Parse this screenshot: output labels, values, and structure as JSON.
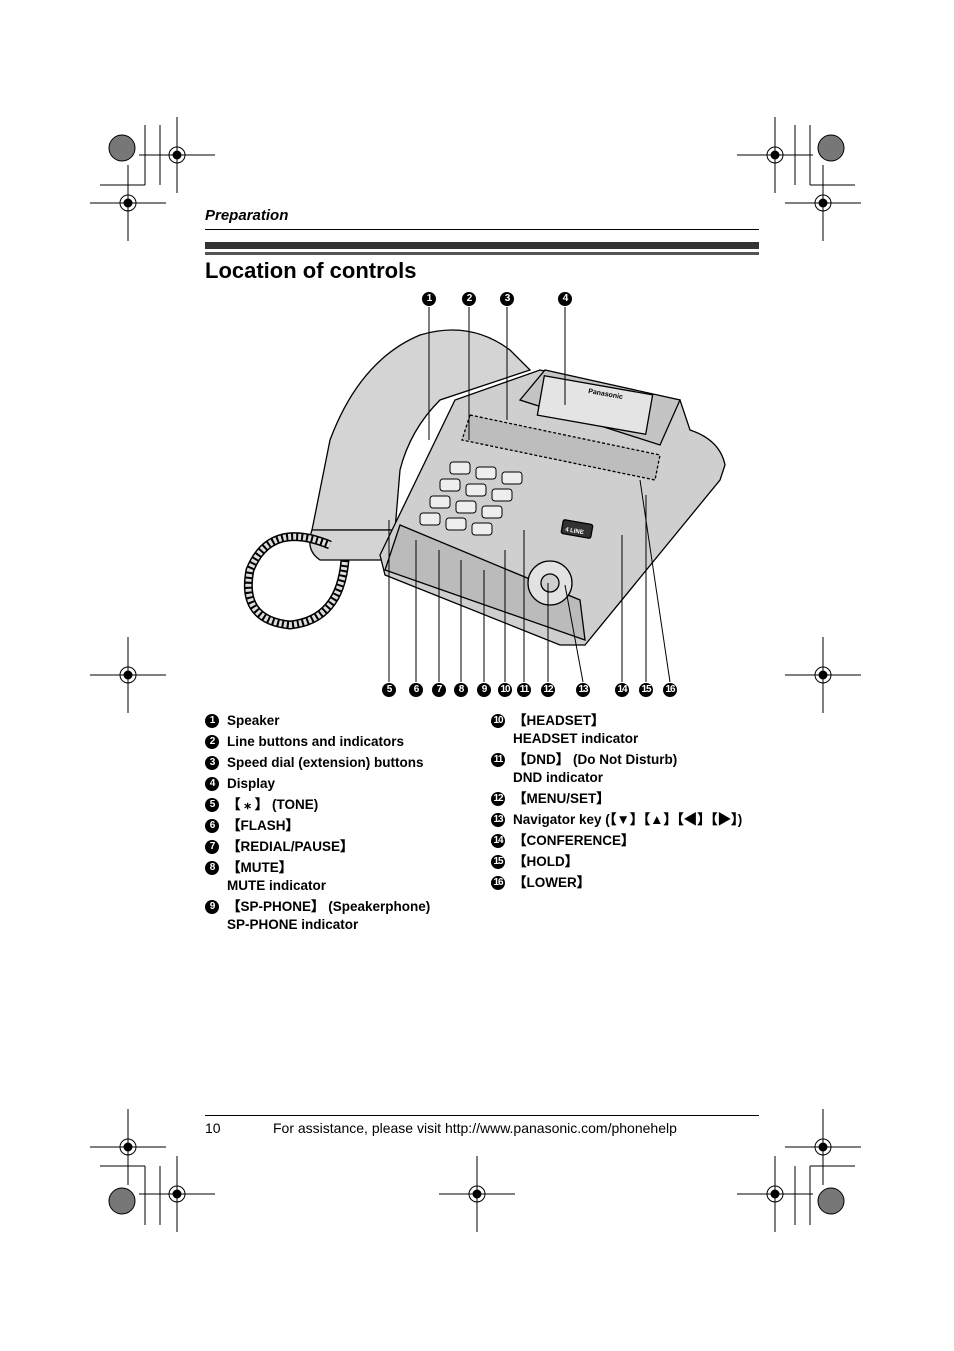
{
  "header": {
    "section": "Preparation",
    "title": "Location of controls"
  },
  "callouts": [
    "1",
    "2",
    "3",
    "4",
    "5",
    "6",
    "7",
    "8",
    "9",
    "10",
    "11",
    "12",
    "13",
    "14",
    "15",
    "16"
  ],
  "left_items": [
    {
      "n": "1",
      "lines": [
        "Speaker"
      ]
    },
    {
      "n": "2",
      "lines": [
        "Line buttons and indicators"
      ]
    },
    {
      "n": "3",
      "lines": [
        "Speed dial (extension) buttons"
      ]
    },
    {
      "n": "4",
      "lines": [
        "Display"
      ]
    },
    {
      "n": "5",
      "lines": [
        "【 ⁎ 】 (TONE)"
      ]
    },
    {
      "n": "6",
      "lines": [
        "【FLASH】"
      ]
    },
    {
      "n": "7",
      "lines": [
        "【REDIAL/PAUSE】"
      ]
    },
    {
      "n": "8",
      "lines": [
        "【MUTE】",
        "MUTE indicator"
      ]
    },
    {
      "n": "9",
      "lines": [
        "【SP-PHONE】 (Speakerphone)",
        "SP-PHONE indicator"
      ]
    }
  ],
  "right_items": [
    {
      "n": "10",
      "lines": [
        "【HEADSET】",
        "HEADSET indicator"
      ]
    },
    {
      "n": "11",
      "lines": [
        "【DND】 (Do Not Disturb)",
        "DND indicator"
      ]
    },
    {
      "n": "12",
      "lines": [
        "【MENU/SET】"
      ]
    },
    {
      "n": "13",
      "lines": [
        "Navigator key (【▼】【▲】【◀】【▶】)"
      ]
    },
    {
      "n": "14",
      "lines": [
        "【CONFERENCE】"
      ]
    },
    {
      "n": "15",
      "lines": [
        "【HOLD】"
      ]
    },
    {
      "n": "16",
      "lines": [
        "【LOWER】"
      ]
    }
  ],
  "phone": {
    "brand": "Panasonic",
    "badge": "4 LINE"
  },
  "footer": {
    "page": "10",
    "text": "For assistance, please visit http://www.panasonic.com/phonehelp"
  }
}
